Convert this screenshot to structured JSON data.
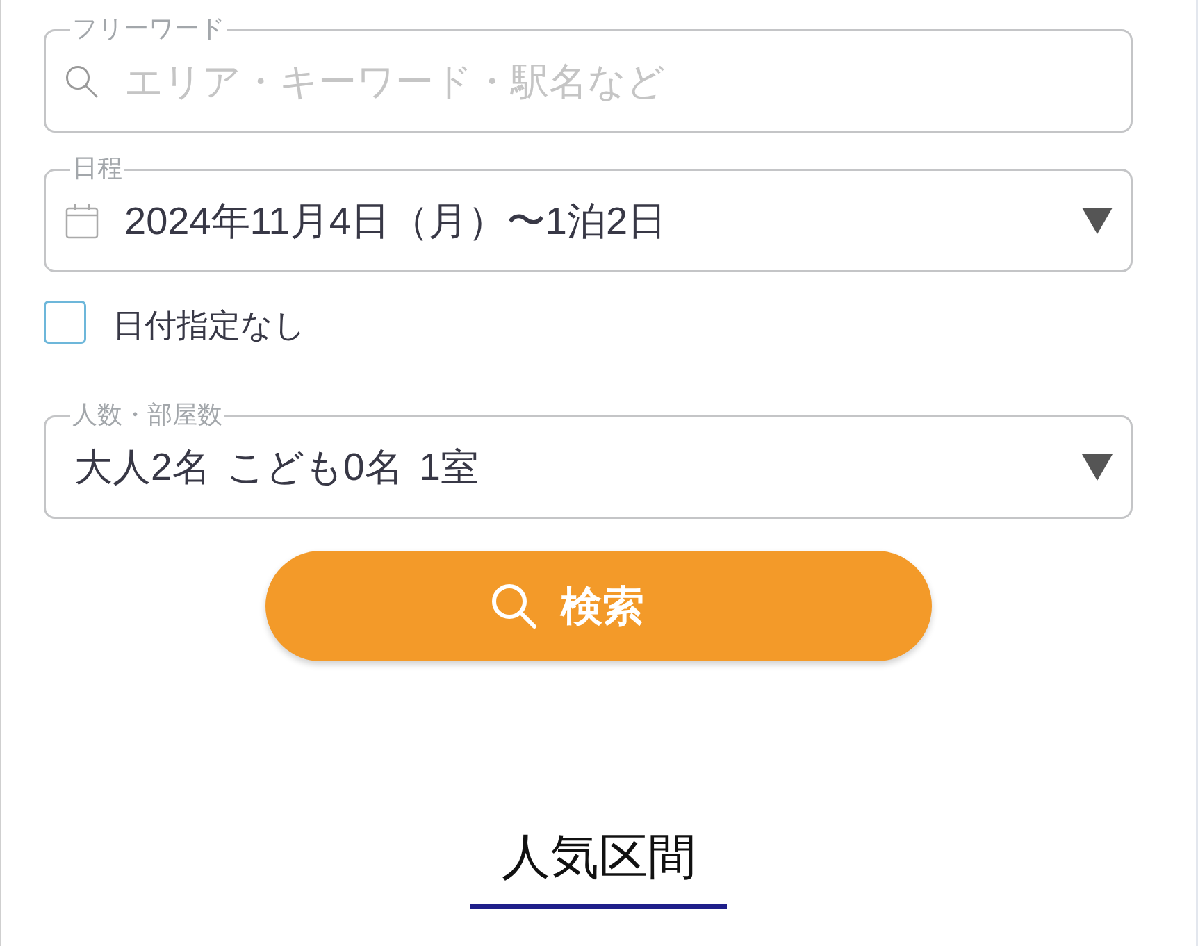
{
  "free_word": {
    "label": "フリーワード",
    "placeholder": "エリア・キーワード・駅名など"
  },
  "schedule": {
    "label": "日程",
    "value": "2024年11月4日（月）〜1泊2日"
  },
  "no_date": {
    "label": "日付指定なし",
    "checked": false
  },
  "guests": {
    "label": "人数・部屋数",
    "value": "大人2名 こども0名 1室"
  },
  "search_button": {
    "label": "検索"
  },
  "section": {
    "title": "人気区間"
  }
}
